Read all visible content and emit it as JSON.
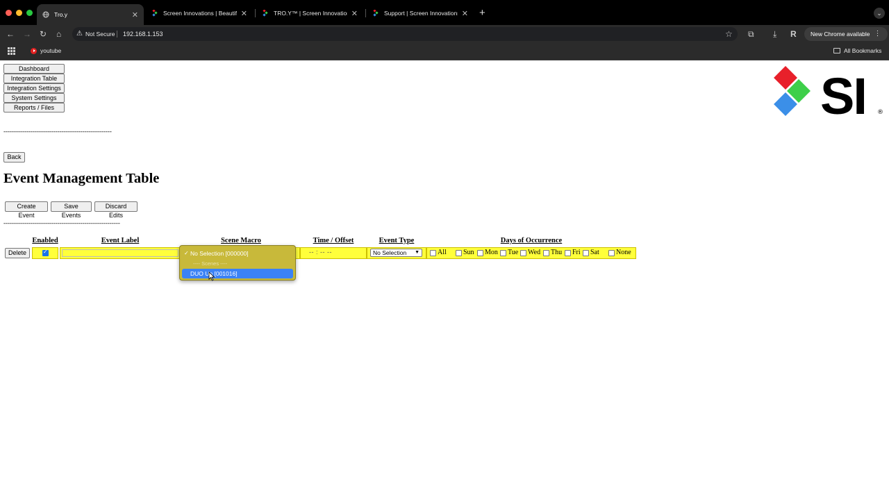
{
  "browser": {
    "tabs": [
      {
        "title": "Tro.y",
        "active": true
      },
      {
        "title": "Screen Innovations | Beautifu",
        "active": false
      },
      {
        "title": "TRO.Y™ | Screen Innovations",
        "active": false
      },
      {
        "title": "Support | Screen Innovations",
        "active": false
      }
    ],
    "security_label": "Not Secure",
    "url": "192.168.1.153",
    "new_chrome_label": "New Chrome available",
    "bookmarks": [
      {
        "label": "youtube"
      }
    ],
    "all_bookmarks_label": "All Bookmarks"
  },
  "nav": {
    "items": [
      {
        "label": "Dashboard"
      },
      {
        "label": "Integration Table"
      },
      {
        "label": "Integration Settings"
      },
      {
        "label": "System Settings"
      },
      {
        "label": "Reports / Files"
      }
    ],
    "divider": "----------------------------------------------------"
  },
  "logo": {
    "text": "SI",
    "registered": "®",
    "colors": {
      "red": "#e8202a",
      "green": "#3ecf4a",
      "blue": "#3b8fe8"
    }
  },
  "page": {
    "back_label": "Back",
    "title": "Event Management Table",
    "actions": {
      "create": "Create Event",
      "save": "Save Events",
      "discard": "Discard Edits"
    },
    "divider": "--------------------------------------------------------"
  },
  "table": {
    "headers": {
      "enabled": "Enabled",
      "event_label": "Event Label",
      "scene_macro": "Scene Macro",
      "time_offset": "Time / Offset",
      "event_type": "Event Type",
      "days": "Days of Occurrence"
    },
    "row": {
      "delete_label": "Delete",
      "enabled": true,
      "event_label_value": "",
      "time_value": "-- : --   --",
      "event_type_value": "No Selection",
      "days": [
        {
          "label": "All",
          "checked": false
        },
        {
          "label": "Sun",
          "checked": false
        },
        {
          "label": "Mon",
          "checked": false
        },
        {
          "label": "Tue",
          "checked": false
        },
        {
          "label": "Wed",
          "checked": false
        },
        {
          "label": "Thu",
          "checked": false
        },
        {
          "label": "Fri",
          "checked": false
        },
        {
          "label": "Sat",
          "checked": false
        },
        {
          "label": "None",
          "checked": false
        }
      ],
      "row_color": "#ffff3b"
    },
    "scene_dropdown": {
      "options": [
        {
          "label": "No Selection [000000]",
          "checked": true
        },
        {
          "label": "---- Scenes ----",
          "separator": true
        },
        {
          "label": "DUO Up [001016]",
          "highlighted": true
        }
      ]
    }
  }
}
